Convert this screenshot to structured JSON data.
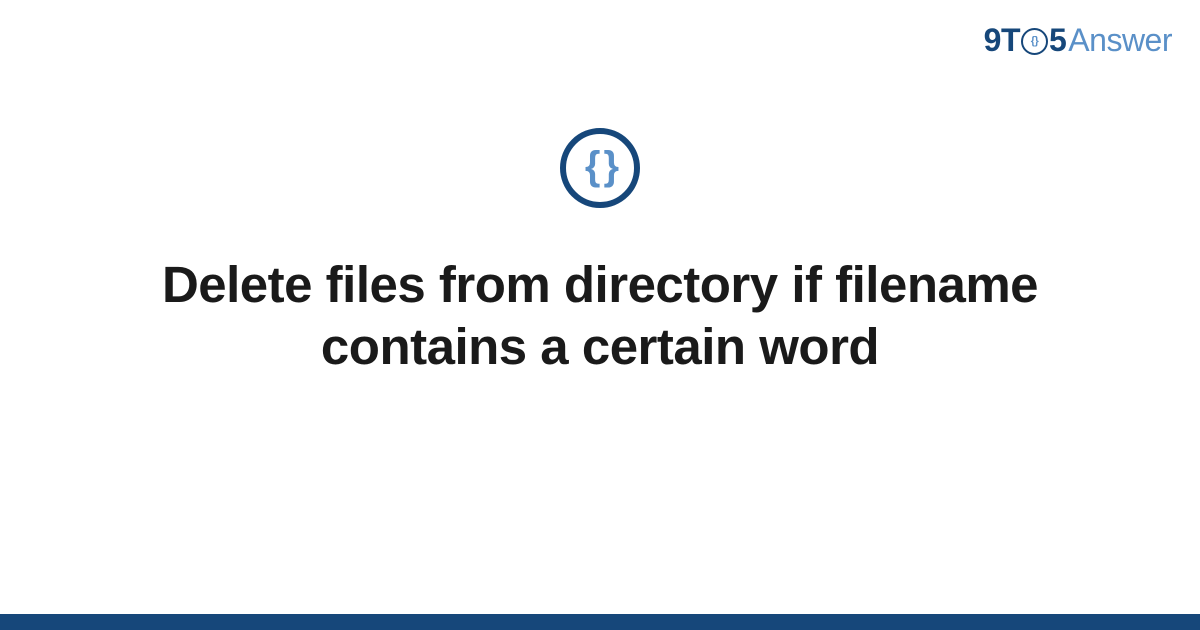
{
  "logo": {
    "prefix": "9T",
    "clock_inner": "{}",
    "suffix": "5",
    "word": "Answer"
  },
  "category_icon": {
    "symbol": "{ }",
    "name": "code-braces"
  },
  "title": "Delete files from directory if filename contains a certain word",
  "colors": {
    "primary_dark": "#16477a",
    "primary_light": "#5a90c8",
    "text": "#1a1a1a",
    "background": "#ffffff"
  }
}
